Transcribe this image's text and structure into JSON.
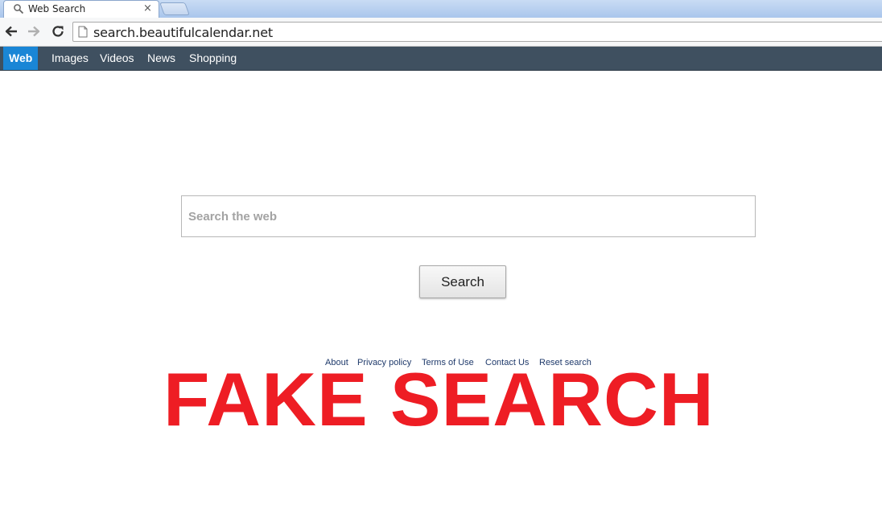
{
  "browser": {
    "tab": {
      "title": "Web Search",
      "close_glyph": "×",
      "favicon": "search-icon"
    },
    "toolbar": {
      "back_icon": "back-arrow-icon",
      "forward_icon": "forward-arrow-icon",
      "reload_icon": "reload-icon",
      "url": "search.beautifulcalendar.net",
      "page_icon": "page-icon"
    }
  },
  "site_nav": {
    "items": [
      {
        "label": "Web",
        "active": true
      },
      {
        "label": "Images",
        "active": false
      },
      {
        "label": "Videos",
        "active": false
      },
      {
        "label": "News",
        "active": false
      },
      {
        "label": "Shopping",
        "active": false
      }
    ]
  },
  "search": {
    "placeholder": "Search the web",
    "value": "",
    "button_label": "Search"
  },
  "footer": {
    "links": [
      "About",
      "Privacy policy",
      "Terms of Use",
      "Contact Us",
      "Reset search"
    ]
  },
  "overlay": {
    "text": "FAKE SEARCH"
  },
  "colors": {
    "nav_bar": "#3f5060",
    "nav_active": "#1a86d6",
    "overlay_text": "#ee1d24",
    "footer_link": "#1f3a6b"
  }
}
